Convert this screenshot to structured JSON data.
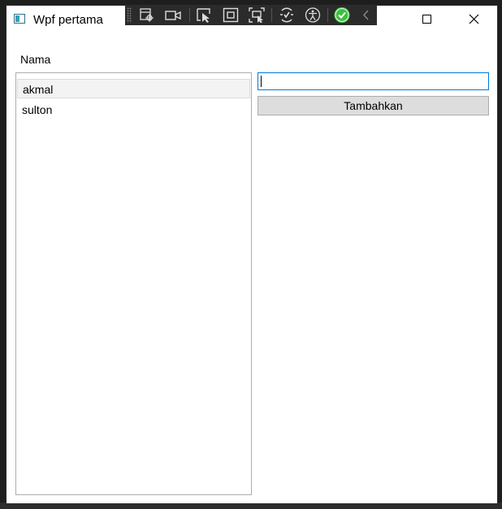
{
  "window": {
    "title": "Wpf pertama"
  },
  "toolbar": {
    "buttons": [
      {
        "icon": "select-element-icon"
      },
      {
        "icon": "video-camera-icon"
      },
      {
        "icon": "pointer-select-icon"
      },
      {
        "icon": "display-layout-icon"
      },
      {
        "icon": "track-focus-icon"
      },
      {
        "icon": "hot-reload-icon"
      },
      {
        "icon": "accessibility-icon"
      },
      {
        "icon": "check-icon"
      },
      {
        "icon": "chevron-left-icon"
      }
    ]
  },
  "form": {
    "label": "Nama",
    "input_value": "",
    "add_button": "Tambahkan"
  },
  "list": {
    "items": [
      {
        "label": "akmal",
        "selected": true
      },
      {
        "label": "sulton",
        "selected": false
      }
    ]
  },
  "colors": {
    "accent": "#0078d7",
    "toolbar_bg": "#2b2b2b",
    "button_bg": "#dddddd",
    "check_green": "#3fbf3f"
  }
}
